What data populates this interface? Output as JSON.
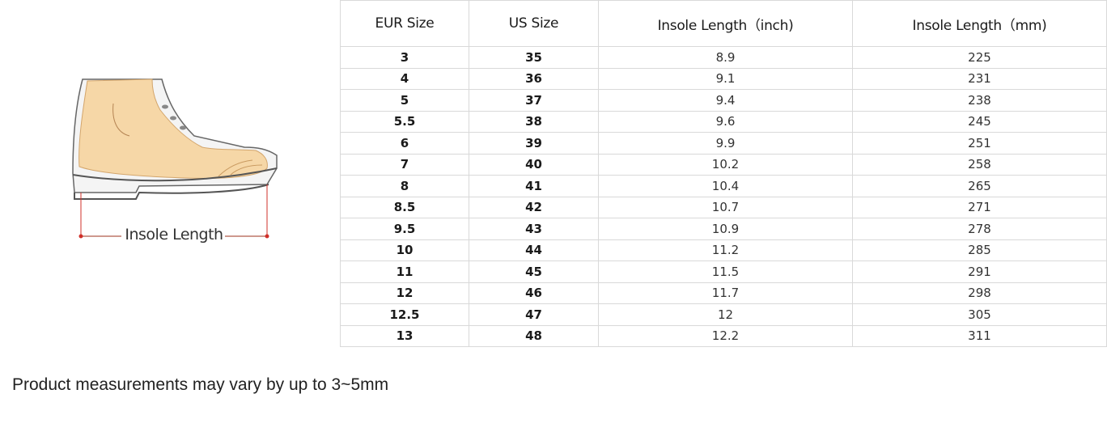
{
  "illustration": {
    "label": "Insole Length",
    "skin_color": "#f6d7a7",
    "marker_color": "#d0302a"
  },
  "table": {
    "headers": [
      "EUR Size",
      "US Size",
      "Insole Length（inch)",
      "Insole Length（mm)"
    ],
    "rows": [
      [
        "3",
        "35",
        "8.9",
        "225"
      ],
      [
        "4",
        "36",
        "9.1",
        "231"
      ],
      [
        "5",
        "37",
        "9.4",
        "238"
      ],
      [
        "5.5",
        "38",
        "9.6",
        "245"
      ],
      [
        "6",
        "39",
        "9.9",
        "251"
      ],
      [
        "7",
        "40",
        "10.2",
        "258"
      ],
      [
        "8",
        "41",
        "10.4",
        "265"
      ],
      [
        "8.5",
        "42",
        "10.7",
        "271"
      ],
      [
        "9.5",
        "43",
        "10.9",
        "278"
      ],
      [
        "10",
        "44",
        "11.2",
        "285"
      ],
      [
        "11",
        "45",
        "11.5",
        "291"
      ],
      [
        "12",
        "46",
        "11.7",
        "298"
      ],
      [
        "12.5",
        "47",
        "12",
        "305"
      ],
      [
        "13",
        "48",
        "12.2",
        "311"
      ]
    ]
  },
  "note": "Product measurements may vary by up to 3~5mm"
}
